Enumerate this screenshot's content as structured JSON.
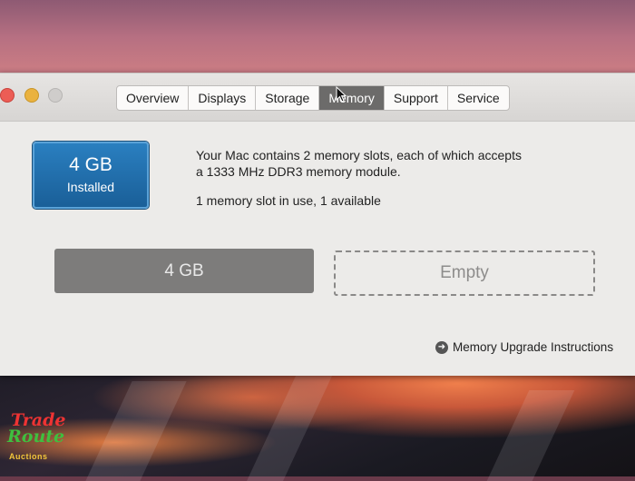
{
  "window": {
    "tabs": [
      {
        "label": "Overview"
      },
      {
        "label": "Displays"
      },
      {
        "label": "Storage"
      },
      {
        "label": "Memory"
      },
      {
        "label": "Support"
      },
      {
        "label": "Service"
      }
    ],
    "selected_tab": "Memory"
  },
  "memory": {
    "badge_size": "4 GB",
    "badge_label": "Installed",
    "description_line1": "Your Mac contains 2 memory slots, each of which accepts",
    "description_line2": "a 1333 MHz DDR3 memory module.",
    "usage": "1 memory slot in use, 1 available",
    "slots": [
      {
        "label": "4 GB"
      },
      {
        "label": "Empty"
      }
    ],
    "upgrade_link": "Memory Upgrade Instructions"
  },
  "watermark": {
    "line1": "Trade",
    "line2": "Route",
    "line3": "Auctions"
  },
  "colors": {
    "selected_tab": "#6c6b6a",
    "badge": "#1f6fae",
    "slot_filled": "#7d7c7b"
  }
}
